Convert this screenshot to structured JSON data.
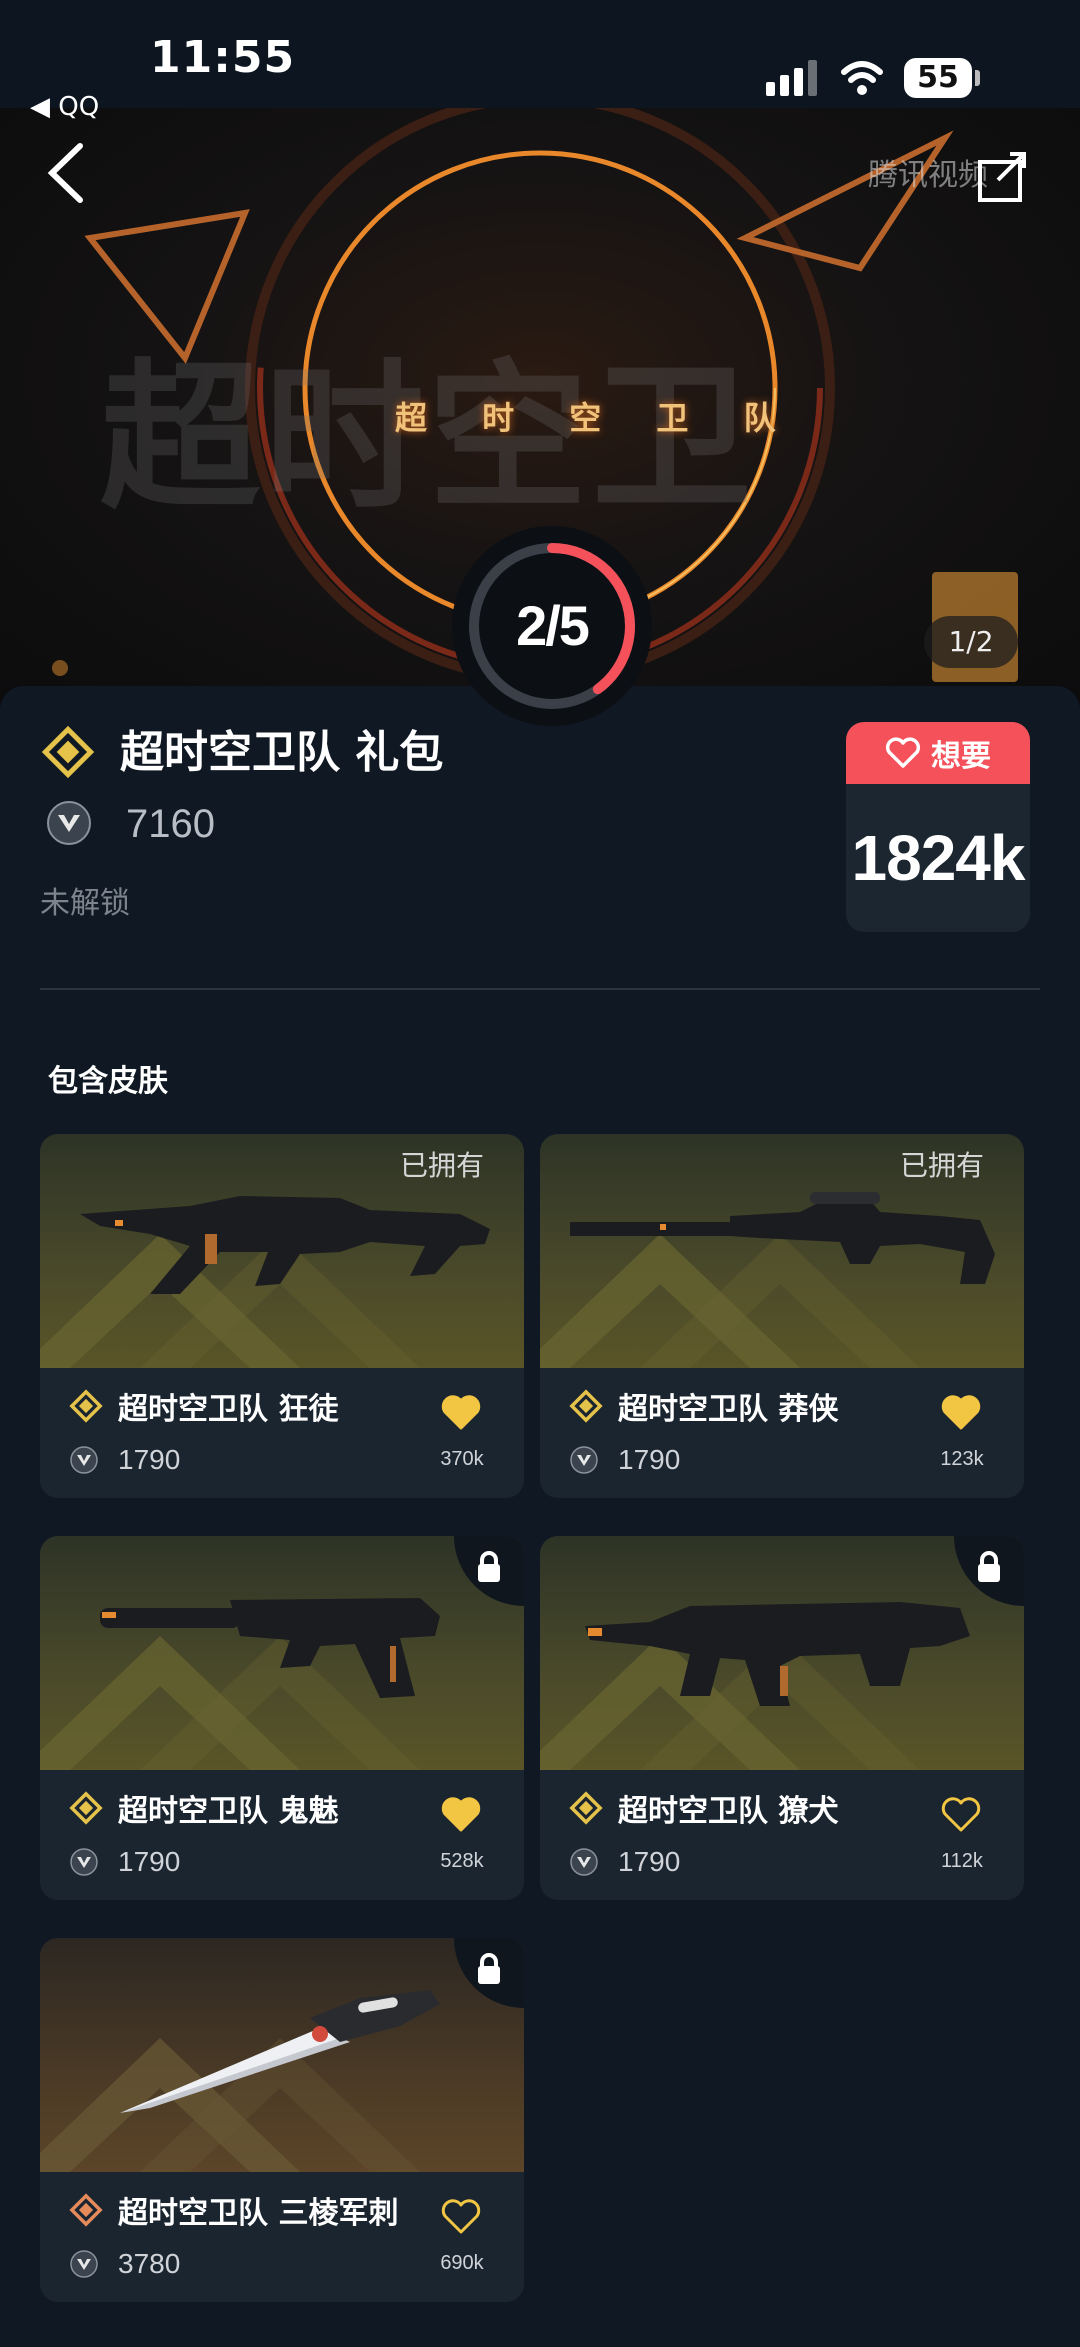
{
  "status_bar": {
    "time": "11:55",
    "back_app": "◀ QQ",
    "battery": "55"
  },
  "hero": {
    "title_text": "超 时 空 卫 队",
    "bg_text": "超时空卫",
    "watermark": "腾讯视频",
    "page_indicator": "1/2",
    "progress": {
      "label": "2/5",
      "current": 2,
      "total": 5
    }
  },
  "bundle": {
    "title": "超时空卫队 礼包",
    "price": "7160",
    "status": "未解锁",
    "want_label": "想要",
    "want_count": "1824k"
  },
  "section_title": "包含皮肤",
  "skins": [
    {
      "name": "超时空卫队 狂徒",
      "price": "1790",
      "likes": "370k",
      "status": "已拥有",
      "owned": true,
      "liked": true,
      "tier_color": "#e5c24a",
      "img": "rifle"
    },
    {
      "name": "超时空卫队 莽侠",
      "price": "1790",
      "likes": "123k",
      "status": "已拥有",
      "owned": true,
      "liked": true,
      "tier_color": "#e5c24a",
      "img": "sniper"
    },
    {
      "name": "超时空卫队 鬼魅",
      "price": "1790",
      "likes": "528k",
      "status": "",
      "owned": false,
      "liked": true,
      "tier_color": "#e5c24a",
      "img": "pistol"
    },
    {
      "name": "超时空卫队 獠犬",
      "price": "1790",
      "likes": "112k",
      "status": "",
      "owned": false,
      "liked": false,
      "tier_color": "#e5c24a",
      "img": "smg"
    },
    {
      "name": "超时空卫队 三棱军刺",
      "price": "3780",
      "likes": "690k",
      "status": "",
      "owned": false,
      "liked": false,
      "tier_color": "#e58a5a",
      "img": "knife"
    }
  ],
  "colors": {
    "accent_red": "#f4515b",
    "gold": "#f2c542",
    "panel": "#1b2530"
  }
}
